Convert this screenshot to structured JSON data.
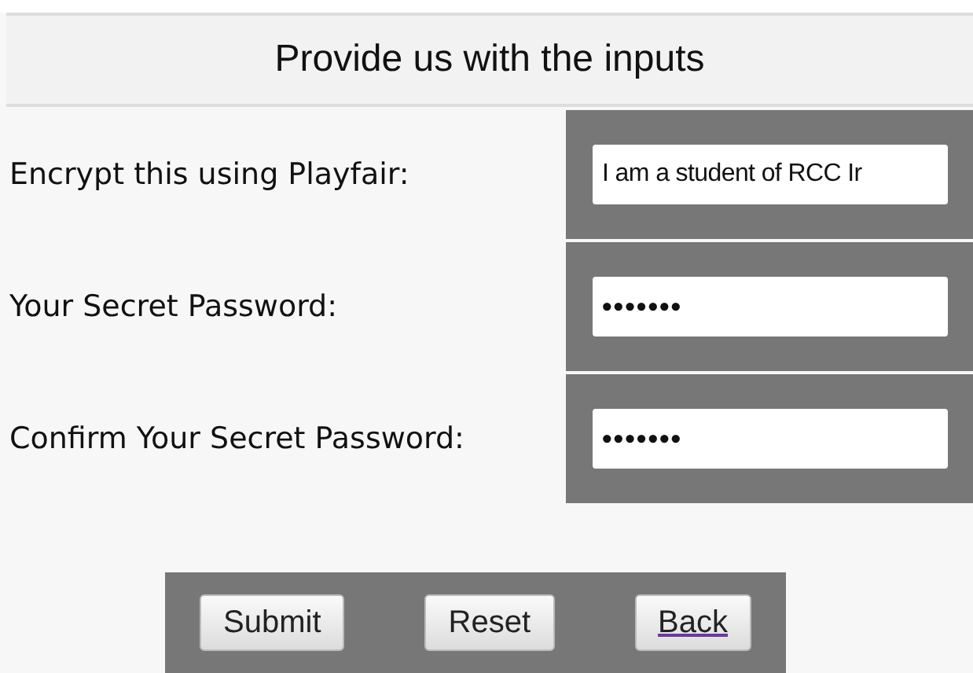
{
  "heading": "Provide us with the inputs",
  "fields": [
    {
      "label": "Encrypt this using Playfair:",
      "value": "I am a student of RCC Ir"
    },
    {
      "label": "Your Secret Password:",
      "value": "•••••••"
    },
    {
      "label": "Confirm Your Secret Password:",
      "value": "•••••••"
    }
  ],
  "buttons": [
    {
      "label": "Submit",
      "kind": "button"
    },
    {
      "label": "Reset",
      "kind": "button"
    },
    {
      "label": "Back",
      "kind": "link"
    }
  ]
}
